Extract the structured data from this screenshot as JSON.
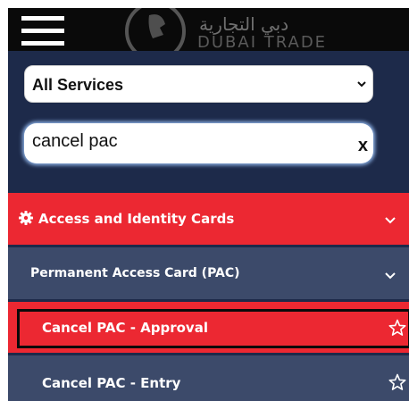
{
  "header": {
    "logo_arabic": "دبي التجارية",
    "logo_english": "DUBAI TRADE"
  },
  "search": {
    "service_filter": "All Services",
    "query": "cancel pac",
    "clear_label": "x"
  },
  "menu": {
    "category": {
      "label": "Access and Identity Cards",
      "icon": "gear-icon"
    },
    "subcategory": {
      "label": "Permanent Access Card (PAC)"
    },
    "results": [
      {
        "label": "Cancel PAC - Approval",
        "selected": true
      },
      {
        "label": "Cancel PAC - Entry",
        "selected": false
      }
    ]
  },
  "colors": {
    "top_bar": "#0a0a0a",
    "panel_background": "#1d2a4a",
    "accent_red": "#ec2832",
    "row_slate": "#3c4a6a"
  }
}
